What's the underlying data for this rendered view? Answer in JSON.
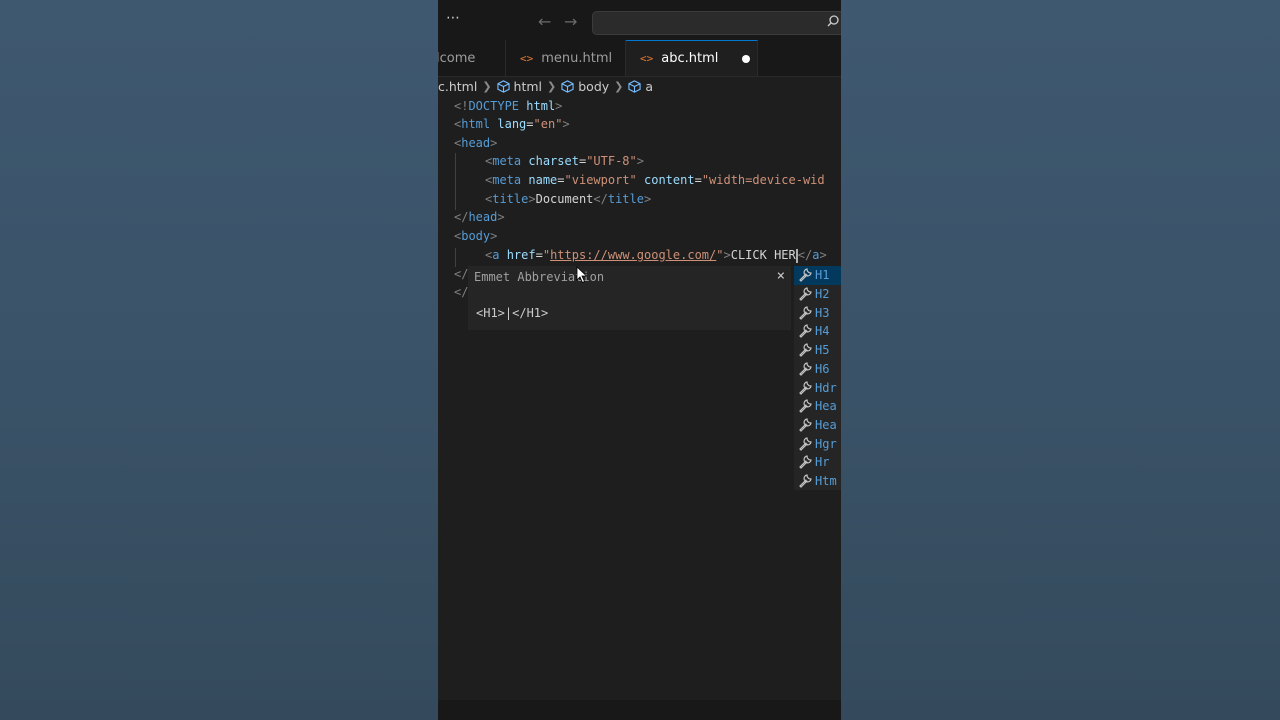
{
  "titlebar": {
    "more_icon": "⋯",
    "back_icon": "←",
    "forward_icon": "→",
    "search_placeholder": ""
  },
  "tabs": [
    {
      "label": "lcome",
      "active": false
    },
    {
      "label": "menu.html",
      "icon": "<>",
      "active": false
    },
    {
      "label": "abc.html",
      "icon": "<>",
      "active": true,
      "dirty": true
    }
  ],
  "breadcrumb": [
    "c.html",
    "html",
    "body",
    "a"
  ],
  "code": {
    "doctype": {
      "open": "<!",
      "name": "DOCTYPE",
      "value": "html",
      "close": ">"
    },
    "html_open": {
      "tag": "html",
      "attr": "lang",
      "value": "\"en\""
    },
    "head_open": "head",
    "meta1": {
      "tag": "meta",
      "attr": "charset",
      "value": "\"UTF-8\""
    },
    "meta2": {
      "tag": "meta",
      "attr1": "name",
      "value1": "\"viewport\"",
      "attr2": "content",
      "value2": "\"width=device-wid"
    },
    "title": {
      "tag": "title",
      "text": "Document"
    },
    "head_close": "head",
    "body_open": "body",
    "anchor": {
      "tag": "a",
      "attr": "href",
      "url": "https://www.google.com/",
      "text": "CLICK HER"
    },
    "close_partial_1": "</",
    "close_partial_2": "</"
  },
  "emmet": {
    "title": "Emmet Abbreviation",
    "close_icon": "×",
    "preview": "<H1>|</H1>"
  },
  "suggestions": [
    "H1",
    "H2",
    "H3",
    "H4",
    "H5",
    "H6",
    "Hdr",
    "Hea",
    "Hea",
    "Hgr",
    "Hr",
    "Htm"
  ],
  "colors": {
    "editor_bg": "#1e1e1e",
    "tag": "#569cd6",
    "attribute": "#9cdcfe",
    "string": "#ce9178",
    "selection": "#04395e"
  }
}
